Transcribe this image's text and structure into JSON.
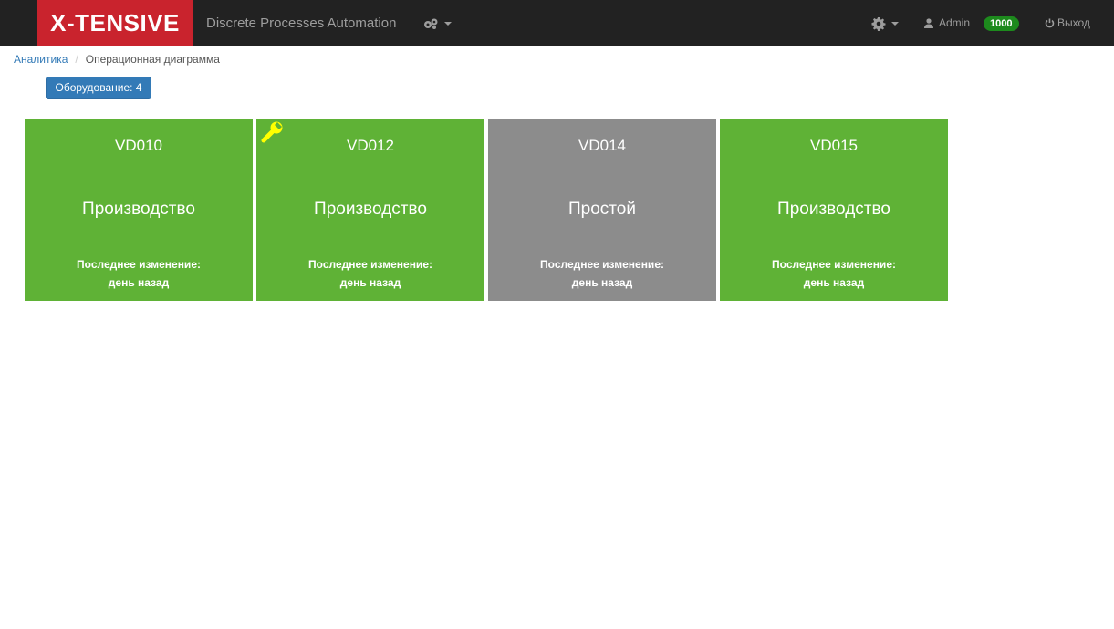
{
  "navbar": {
    "brand": "X-TENSIVE",
    "app_title": "Discrete Processes Automation",
    "user_name": "Admin",
    "user_badge": "1000",
    "logout_label": "Выход",
    "icons": [
      "cogs-icon",
      "gear-icon",
      "user-icon",
      "power-icon"
    ]
  },
  "breadcrumb": {
    "items": [
      "Аналитика",
      "Операционная диаграмма"
    ],
    "separator": "/"
  },
  "toolbar": {
    "equipment_label": "Оборудование: 4"
  },
  "tiles": [
    {
      "name": "VD010",
      "status": "Производство",
      "change_label": "Последнее изменение:",
      "change_value": "день назад",
      "color": "#5fb236",
      "maintenance": false
    },
    {
      "name": "VD012",
      "status": "Производство",
      "change_label": "Последнее изменение:",
      "change_value": "день назад",
      "color": "#5fb236",
      "maintenance": true
    },
    {
      "name": "VD014",
      "status": "Простой",
      "change_label": "Последнее изменение:",
      "change_value": "день назад",
      "color": "#8c8c8c",
      "maintenance": false
    },
    {
      "name": "VD015",
      "status": "Производство",
      "change_label": "Последнее изменение:",
      "change_value": "день назад",
      "color": "#5fb236",
      "maintenance": false
    }
  ],
  "colors": {
    "navbar_bg": "#222222",
    "brand_bg": "#c9232d",
    "production": "#5fb236",
    "idle": "#8c8c8c",
    "primary": "#337ab7",
    "badge": "#1d8a1d",
    "wrench": "#ffff00"
  }
}
